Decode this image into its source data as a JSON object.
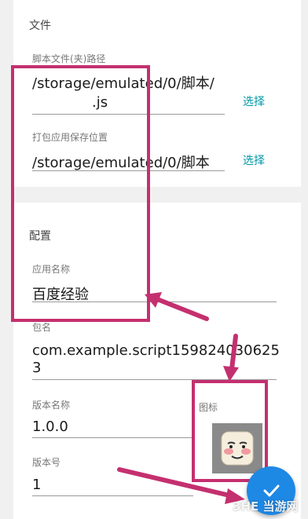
{
  "files_section": {
    "title": "文件",
    "script_path": {
      "label": "脚本文件(夹)路径",
      "value_line1": "/storage/emulated/0/脚本/",
      "value_line2": ".js",
      "button": "选择"
    },
    "save_path": {
      "label": "打包应用保存位置",
      "value": "/storage/emulated/0/脚本",
      "button": "选择"
    }
  },
  "config_section": {
    "title": "配置",
    "app_name": {
      "label": "应用名称",
      "value": "百度经验"
    },
    "package": {
      "label": "包名",
      "value_line1": "com.example.script159824030625",
      "value_line2": "3"
    },
    "version_name": {
      "label": "版本名称",
      "value": "1.0.0"
    },
    "icon": {
      "label": "图标",
      "icon_name": "meme-face-icon"
    },
    "version_code": {
      "label": "版本号",
      "value": "1"
    }
  },
  "fab": {
    "icon": "check-icon"
  },
  "watermark": {
    "text": "3HE 当游网"
  },
  "colors": {
    "accent": "#0097a7",
    "fab": "#1e88e5",
    "annotation": "#c4306f"
  }
}
